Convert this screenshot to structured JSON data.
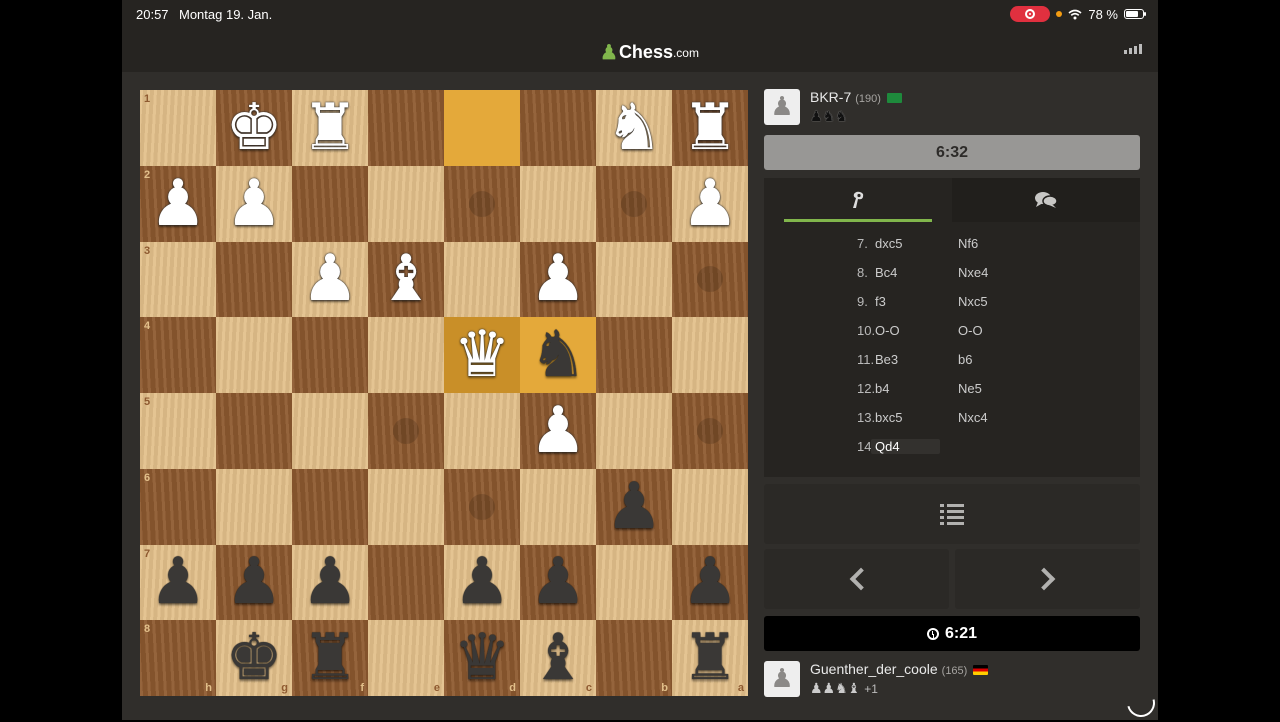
{
  "status_bar": {
    "time": "20:57",
    "date": "Montag 19. Jan.",
    "battery": "78 %"
  },
  "header": {
    "logo_name": "Chess",
    "logo_suffix": ".com"
  },
  "board": {
    "squares": [
      {
        "p": "",
        "c": "",
        "hint": false,
        "hl": false,
        "rank": "1",
        "file": ""
      },
      {
        "p": "♚",
        "c": "w",
        "hint": false,
        "hl": false,
        "rank": "",
        "file": ""
      },
      {
        "p": "♜",
        "c": "w",
        "hint": false,
        "hl": false,
        "rank": "",
        "file": ""
      },
      {
        "p": "",
        "c": "",
        "hint": false,
        "hl": false,
        "rank": "",
        "file": ""
      },
      {
        "p": "",
        "c": "",
        "hint": false,
        "hl": true,
        "rank": "",
        "file": ""
      },
      {
        "p": "",
        "c": "",
        "hint": false,
        "hl": false,
        "rank": "",
        "file": ""
      },
      {
        "p": "♞",
        "c": "w",
        "hint": false,
        "hl": false,
        "rank": "",
        "file": ""
      },
      {
        "p": "♜",
        "c": "w",
        "hint": false,
        "hl": false,
        "rank": "",
        "file": ""
      },
      {
        "p": "♟",
        "c": "w",
        "hint": false,
        "hl": false,
        "rank": "2",
        "file": ""
      },
      {
        "p": "♟",
        "c": "w",
        "hint": false,
        "hl": false,
        "rank": "",
        "file": ""
      },
      {
        "p": "",
        "c": "",
        "hint": false,
        "hl": false,
        "rank": "",
        "file": ""
      },
      {
        "p": "",
        "c": "",
        "hint": false,
        "hl": false,
        "rank": "",
        "file": ""
      },
      {
        "p": "",
        "c": "",
        "hint": true,
        "hl": false,
        "rank": "",
        "file": ""
      },
      {
        "p": "",
        "c": "",
        "hint": false,
        "hl": false,
        "rank": "",
        "file": ""
      },
      {
        "p": "",
        "c": "",
        "hint": true,
        "hl": false,
        "rank": "",
        "file": ""
      },
      {
        "p": "♟",
        "c": "w",
        "hint": false,
        "hl": false,
        "rank": "",
        "file": ""
      },
      {
        "p": "",
        "c": "",
        "hint": false,
        "hl": false,
        "rank": "3",
        "file": ""
      },
      {
        "p": "",
        "c": "",
        "hint": false,
        "hl": false,
        "rank": "",
        "file": ""
      },
      {
        "p": "♟",
        "c": "w",
        "hint": false,
        "hl": false,
        "rank": "",
        "file": ""
      },
      {
        "p": "♝",
        "c": "w",
        "hint": false,
        "hl": false,
        "rank": "",
        "file": ""
      },
      {
        "p": "",
        "c": "",
        "hint": false,
        "hl": false,
        "rank": "",
        "file": ""
      },
      {
        "p": "♟",
        "c": "w",
        "hint": false,
        "hl": false,
        "rank": "",
        "file": ""
      },
      {
        "p": "",
        "c": "",
        "hint": false,
        "hl": false,
        "rank": "",
        "file": ""
      },
      {
        "p": "",
        "c": "",
        "hint": true,
        "hl": false,
        "rank": "",
        "file": ""
      },
      {
        "p": "",
        "c": "",
        "hint": false,
        "hl": false,
        "rank": "4",
        "file": ""
      },
      {
        "p": "",
        "c": "",
        "hint": false,
        "hl": false,
        "rank": "",
        "file": ""
      },
      {
        "p": "",
        "c": "",
        "hint": false,
        "hl": false,
        "rank": "",
        "file": ""
      },
      {
        "p": "",
        "c": "",
        "hint": false,
        "hl": false,
        "rank": "",
        "file": ""
      },
      {
        "p": "♛",
        "c": "w",
        "hint": false,
        "hl": true,
        "rank": "",
        "file": ""
      },
      {
        "p": "♞",
        "c": "b",
        "hint": false,
        "hl": true,
        "rank": "",
        "file": ""
      },
      {
        "p": "",
        "c": "",
        "hint": false,
        "hl": false,
        "rank": "",
        "file": ""
      },
      {
        "p": "",
        "c": "",
        "hint": false,
        "hl": false,
        "rank": "",
        "file": ""
      },
      {
        "p": "",
        "c": "",
        "hint": false,
        "hl": false,
        "rank": "5",
        "file": ""
      },
      {
        "p": "",
        "c": "",
        "hint": false,
        "hl": false,
        "rank": "",
        "file": ""
      },
      {
        "p": "",
        "c": "",
        "hint": false,
        "hl": false,
        "rank": "",
        "file": ""
      },
      {
        "p": "",
        "c": "",
        "hint": true,
        "hl": false,
        "rank": "",
        "file": ""
      },
      {
        "p": "",
        "c": "",
        "hint": false,
        "hl": false,
        "rank": "",
        "file": ""
      },
      {
        "p": "♟",
        "c": "w",
        "hint": false,
        "hl": false,
        "rank": "",
        "file": ""
      },
      {
        "p": "",
        "c": "",
        "hint": false,
        "hl": false,
        "rank": "",
        "file": ""
      },
      {
        "p": "",
        "c": "",
        "hint": true,
        "hl": false,
        "rank": "",
        "file": ""
      },
      {
        "p": "",
        "c": "",
        "hint": false,
        "hl": false,
        "rank": "6",
        "file": ""
      },
      {
        "p": "",
        "c": "",
        "hint": false,
        "hl": false,
        "rank": "",
        "file": ""
      },
      {
        "p": "",
        "c": "",
        "hint": false,
        "hl": false,
        "rank": "",
        "file": ""
      },
      {
        "p": "",
        "c": "",
        "hint": false,
        "hl": false,
        "rank": "",
        "file": ""
      },
      {
        "p": "",
        "c": "",
        "hint": true,
        "hl": false,
        "rank": "",
        "file": ""
      },
      {
        "p": "",
        "c": "",
        "hint": false,
        "hl": false,
        "rank": "",
        "file": ""
      },
      {
        "p": "♟",
        "c": "b",
        "hint": false,
        "hl": false,
        "rank": "",
        "file": ""
      },
      {
        "p": "",
        "c": "",
        "hint": false,
        "hl": false,
        "rank": "",
        "file": ""
      },
      {
        "p": "♟",
        "c": "b",
        "hint": false,
        "hl": false,
        "rank": "7",
        "file": ""
      },
      {
        "p": "♟",
        "c": "b",
        "hint": false,
        "hl": false,
        "rank": "",
        "file": ""
      },
      {
        "p": "♟",
        "c": "b",
        "hint": false,
        "hl": false,
        "rank": "",
        "file": ""
      },
      {
        "p": "",
        "c": "",
        "hint": false,
        "hl": false,
        "rank": "",
        "file": ""
      },
      {
        "p": "♟",
        "c": "b",
        "hint": false,
        "hl": false,
        "rank": "",
        "file": ""
      },
      {
        "p": "♟",
        "c": "b",
        "hint": false,
        "hl": false,
        "rank": "",
        "file": ""
      },
      {
        "p": "",
        "c": "",
        "hint": false,
        "hl": false,
        "rank": "",
        "file": ""
      },
      {
        "p": "♟",
        "c": "b",
        "hint": false,
        "hl": false,
        "rank": "",
        "file": ""
      },
      {
        "p": "",
        "c": "",
        "hint": false,
        "hl": false,
        "rank": "8",
        "file": "h"
      },
      {
        "p": "♚",
        "c": "b",
        "hint": false,
        "hl": false,
        "rank": "",
        "file": "g"
      },
      {
        "p": "♜",
        "c": "b",
        "hint": false,
        "hl": false,
        "rank": "",
        "file": "f"
      },
      {
        "p": "",
        "c": "",
        "hint": false,
        "hl": false,
        "rank": "",
        "file": "e"
      },
      {
        "p": "♛",
        "c": "b",
        "hint": false,
        "hl": false,
        "rank": "",
        "file": "d"
      },
      {
        "p": "♝",
        "c": "b",
        "hint": false,
        "hl": false,
        "rank": "",
        "file": "c"
      },
      {
        "p": "",
        "c": "",
        "hint": false,
        "hl": false,
        "rank": "",
        "file": "b"
      },
      {
        "p": "♜",
        "c": "b",
        "hint": false,
        "hl": false,
        "rank": "",
        "file": "a"
      }
    ]
  },
  "opponent": {
    "avatar": "♟",
    "name": "BKR-7",
    "rating": "(190)",
    "flag": "sa",
    "captured": "♟♞♞"
  },
  "opponent_clock": "6:32",
  "move_panel": {
    "tabs": [
      {
        "name": "tab-moves",
        "icon": "move-list-icon"
      },
      {
        "name": "tab-chat",
        "icon": "chat-icon"
      }
    ],
    "moves": [
      {
        "num": "7.",
        "white": "dxc5",
        "black": "Nf6"
      },
      {
        "num": "8.",
        "white": "Bc4",
        "black": "Nxe4"
      },
      {
        "num": "9.",
        "white": "f3",
        "black": "Nxc5"
      },
      {
        "num": "10.",
        "white": "O-O",
        "black": "O-O"
      },
      {
        "num": "11.",
        "white": "Be3",
        "black": "b6"
      },
      {
        "num": "12.",
        "white": "b4",
        "black": "Ne5"
      },
      {
        "num": "13.",
        "white": "bxc5",
        "black": "Nxc4"
      },
      {
        "num": "14.",
        "white": "Qd4",
        "black": ""
      }
    ],
    "current_move_index": 7
  },
  "player_clock": "6:21",
  "player": {
    "avatar": "♟",
    "name": "Guenther_der_coole",
    "rating": "(165)",
    "flag": "de",
    "captured": "♟♟♞♝",
    "advantage": "+1"
  },
  "colors": {
    "accent": "#81b64c",
    "bg": "#302e2b",
    "panel": "#262421",
    "light_square": "#e2bf8a",
    "dark_square": "#8e5a30",
    "highlight": "#e4a93a"
  }
}
